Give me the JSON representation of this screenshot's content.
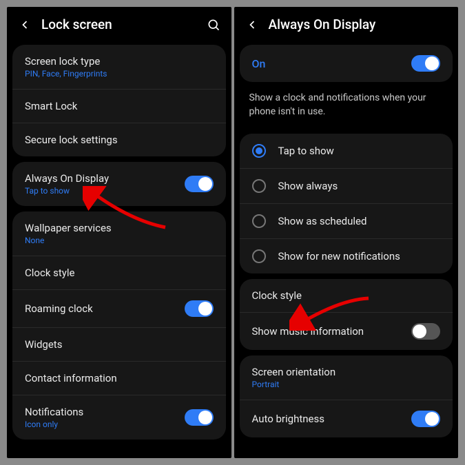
{
  "left": {
    "title": "Lock screen",
    "group1": [
      {
        "label": "Screen lock type",
        "sub": "PIN, Face, Fingerprints"
      },
      {
        "label": "Smart Lock"
      },
      {
        "label": "Secure lock settings"
      }
    ],
    "aod": {
      "label": "Always On Display",
      "sub": "Tap to show",
      "toggle": true
    },
    "group2": [
      {
        "label": "Wallpaper services",
        "sub": "None"
      },
      {
        "label": "Clock style"
      },
      {
        "label": "Roaming clock",
        "toggle": true
      },
      {
        "label": "Widgets"
      },
      {
        "label": "Contact information"
      },
      {
        "label": "Notifications",
        "sub": "Icon only",
        "toggle": true
      }
    ]
  },
  "right": {
    "title": "Always On Display",
    "on_label": "On",
    "desc": "Show a clock and notifications when your phone isn't in use.",
    "radios": [
      {
        "label": "Tap to show",
        "selected": true
      },
      {
        "label": "Show always",
        "selected": false
      },
      {
        "label": "Show as scheduled",
        "selected": false
      },
      {
        "label": "Show for new notifications",
        "selected": false
      }
    ],
    "group2": [
      {
        "label": "Clock style"
      },
      {
        "label": "Show music information",
        "toggle": false
      }
    ],
    "group3": [
      {
        "label": "Screen orientation",
        "sub": "Portrait"
      },
      {
        "label": "Auto brightness",
        "toggle": true
      }
    ]
  }
}
